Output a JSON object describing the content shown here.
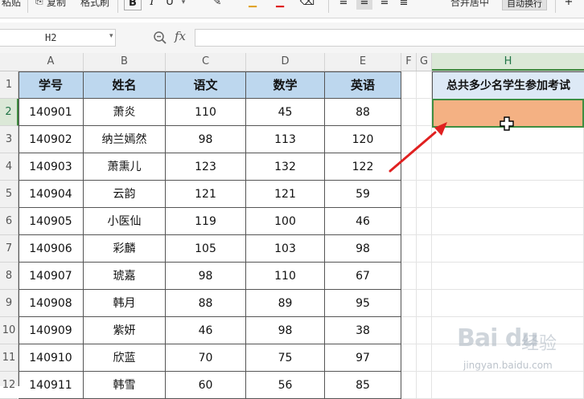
{
  "ribbon": {
    "paste_label": "粘贴",
    "copy_label": "复制",
    "format_painter_label": "格式刷",
    "bold_label": "B",
    "italic_label": "I",
    "merge_label": "合并居中",
    "wrap_label": "自动换行"
  },
  "formula_bar": {
    "name_box": "H2",
    "fx_label": "fx",
    "formula": ""
  },
  "columns": [
    "A",
    "B",
    "C",
    "D",
    "E",
    "F",
    "G",
    "H"
  ],
  "selected_column": "H",
  "rows": [
    "1",
    "2",
    "3",
    "4",
    "5",
    "6",
    "7",
    "8",
    "9",
    "10",
    "11",
    "12"
  ],
  "selected_row": "2",
  "table": {
    "headers": [
      "学号",
      "姓名",
      "语文",
      "数学",
      "英语"
    ],
    "data": [
      [
        "140901",
        "萧炎",
        "110",
        "45",
        "88"
      ],
      [
        "140902",
        "纳兰嫣然",
        "98",
        "113",
        "120"
      ],
      [
        "140903",
        "萧熏儿",
        "123",
        "132",
        "122"
      ],
      [
        "140904",
        "云韵",
        "121",
        "121",
        "59"
      ],
      [
        "140905",
        "小医仙",
        "119",
        "100",
        "46"
      ],
      [
        "140906",
        "彩麟",
        "105",
        "103",
        "98"
      ],
      [
        "140907",
        "琥嘉",
        "98",
        "110",
        "67"
      ],
      [
        "140908",
        "韩月",
        "88",
        "89",
        "95"
      ],
      [
        "140909",
        "紫妍",
        "46",
        "98",
        "38"
      ],
      [
        "140910",
        "欣蓝",
        "70",
        "75",
        "97"
      ],
      [
        "140911",
        "韩雪",
        "60",
        "56",
        "85"
      ]
    ]
  },
  "h1_text": "总共多少名学生参加考试",
  "h2_value": "",
  "colors": {
    "header_fill": "#bdd7ee",
    "selected_fill": "#f4b183",
    "selection_border": "#3e8e41",
    "arrow": "#e02020"
  },
  "watermark": {
    "logo": "Bai  du",
    "sub": "经验",
    "url": "jingyan.baidu.com"
  }
}
